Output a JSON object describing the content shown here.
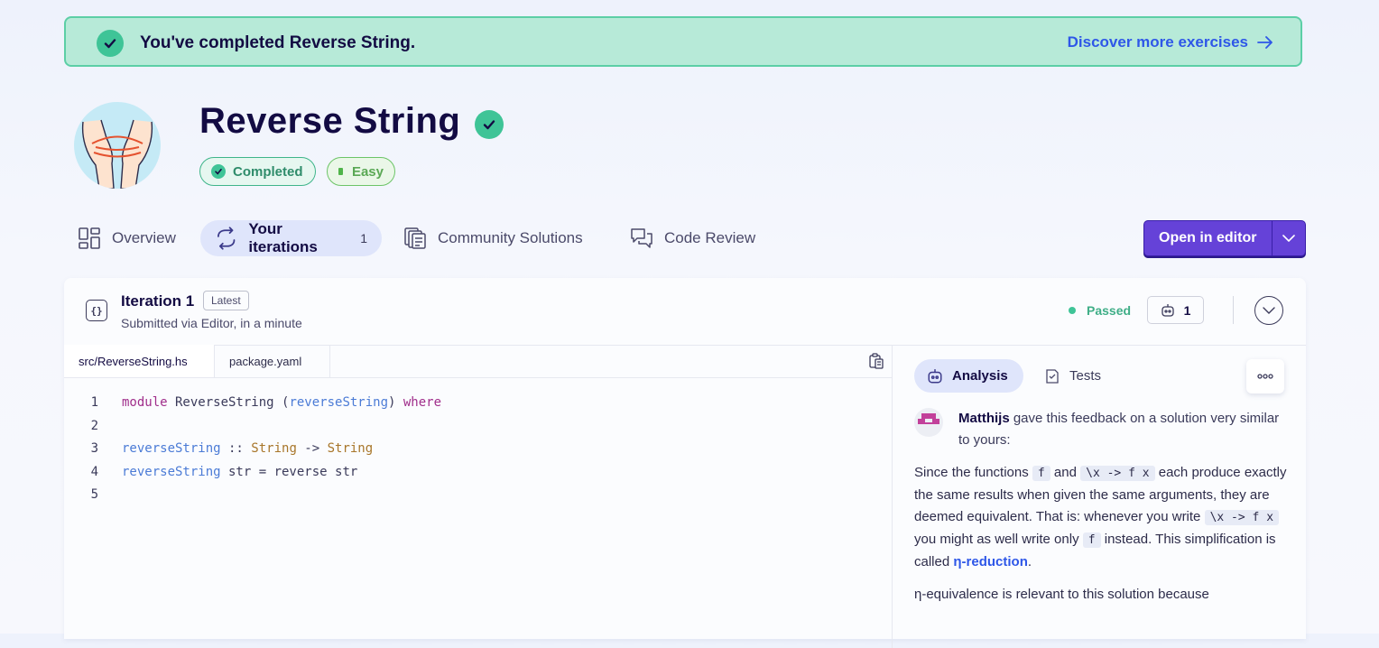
{
  "banner": {
    "message": "You've completed Reverse String.",
    "link": "Discover more exercises"
  },
  "exercise": {
    "title": "Reverse String",
    "status_pill": "Completed",
    "difficulty_pill": "Easy"
  },
  "tabs": [
    {
      "label": "Overview"
    },
    {
      "label": "Your iterations",
      "count": "1"
    },
    {
      "label": "Community Solutions"
    },
    {
      "label": "Code Review"
    }
  ],
  "editor_button": {
    "label": "Open in editor"
  },
  "iteration": {
    "title": "Iteration 1",
    "badge": "Latest",
    "subtitle": "Submitted via Editor, in a minute",
    "status": "Passed",
    "analyzer_count": "1"
  },
  "files": [
    "src/ReverseString.hs",
    "package.yaml"
  ],
  "code_lines": [
    {
      "n": "1",
      "text": "module ReverseString (reverseString) where"
    },
    {
      "n": "2",
      "text": ""
    },
    {
      "n": "3",
      "text": "reverseString :: String -> String"
    },
    {
      "n": "4",
      "text": "reverseString str = reverse str"
    },
    {
      "n": "5",
      "text": ""
    }
  ],
  "right_tabs": {
    "analysis": "Analysis",
    "tests": "Tests"
  },
  "feedback": {
    "author": "Matthijs",
    "intro": " gave this feedback on a solution very similar to yours:",
    "p1": {
      "t1": "Since the functions ",
      "c1": "f",
      "t2": " and ",
      "c2": "\\x -> f x",
      "t3": " each produce exactly the same results when given the same arguments, they are deemed equivalent. That is: whenever you write ",
      "c3": "\\x -> f x",
      "t4": " you might as well write only ",
      "c4": "f",
      "t5": " instead. This simplification is called ",
      "link": "η-reduction",
      "t6": "."
    },
    "p2": "η-equivalence is relevant to this solution because"
  },
  "colors": {
    "accent": "#6542d8",
    "success": "#3fc497",
    "link": "#2e57e8",
    "banner_bg": "#b7ead8"
  }
}
